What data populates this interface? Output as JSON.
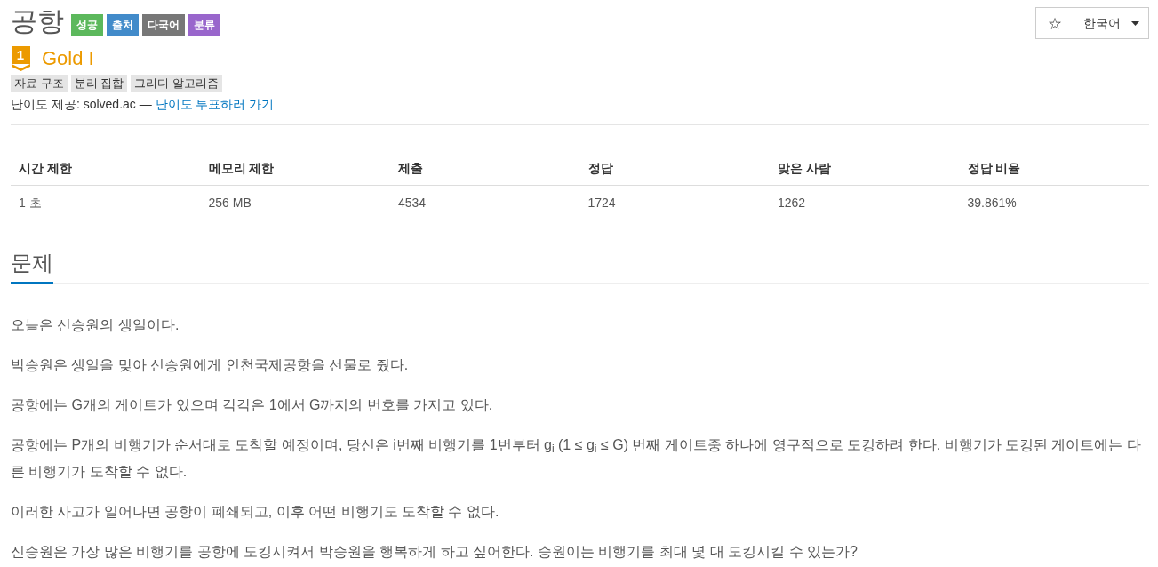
{
  "title": "공항",
  "labels": [
    {
      "text": "성공",
      "color": "#5cb85c"
    },
    {
      "text": "출처",
      "color": "#428bca"
    },
    {
      "text": "다국어",
      "color": "#777777"
    },
    {
      "text": "분류",
      "color": "#9966cc"
    }
  ],
  "toolbar": {
    "star": "☆",
    "language": "한국어"
  },
  "tier": {
    "number": "1",
    "name": "Gold I"
  },
  "tags": [
    "자료 구조",
    "분리 집합",
    "그리디 알고리즘"
  ],
  "difficulty_note": {
    "text": "난이도 제공: solved.ac — ",
    "link": "난이도 투표하러 가기"
  },
  "info_table": {
    "columns": [
      "시간 제한",
      "메모리 제한",
      "제출",
      "정답",
      "맞은 사람",
      "정답 비율"
    ],
    "rows": [
      [
        "1 초",
        "256 MB",
        "4534",
        "1724",
        "1262",
        "39.861%"
      ]
    ]
  },
  "section": {
    "heading": "문제",
    "paragraphs": [
      "오늘은 신승원의 생일이다.",
      "박승원은 생일을 맞아 신승원에게 인천국제공항을 선물로 줬다.",
      "공항에는 G개의 게이트가 있으며 각각은 1에서 G까지의 번호를 가지고 있다.",
      "공항에는 P개의 비행기가 순서대로 도착할 예정이며, 당신은 i번째 비행기를 1번부터 g$_{i}$ (1 ≤ g$_{i}$ ≤ G) 번째 게이트중 하나에 영구적으로 도킹하려 한다. 비행기가 도킹된 게이트에는 다른 비행기가 도착할 수 없다.",
      "이러한 사고가 일어나면 공항이 폐쇄되고, 이후 어떤 비행기도 도착할 수 없다.",
      "신승원은 가장 많은 비행기를 공항에 도킹시켜서 박승원을 행복하게 하고 싶어한다. 승원이는 비행기를 최대 몇 대 도킹시킬 수 있는가?"
    ]
  }
}
